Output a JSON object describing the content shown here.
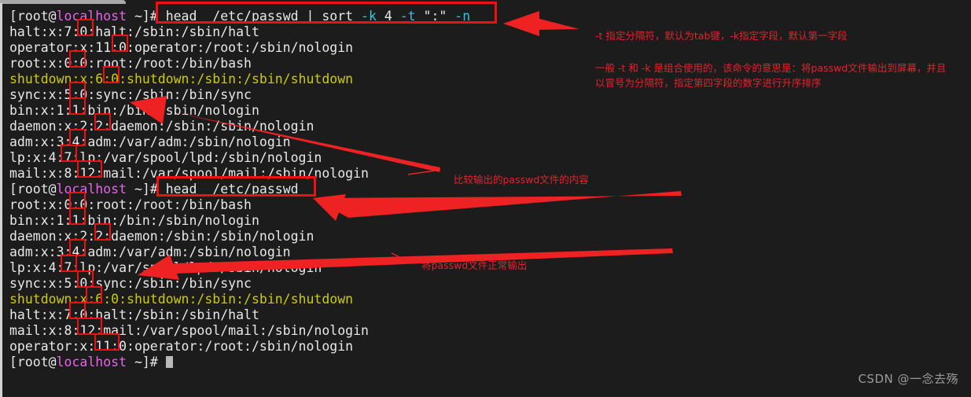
{
  "terminal": {
    "prompt": {
      "user_host_pre": "[root@",
      "host": "localhost",
      "post": " ~]# "
    },
    "lines": [
      {
        "kind": "prompt",
        "command": "head  /etc/passwd | sort ",
        "flags": "-k",
        "mid": " 4 ",
        "flag2": "-t",
        "mid2": " \":\" ",
        "flag3": "-n"
      },
      {
        "kind": "out",
        "color": "white",
        "text": "halt:x:7:0:halt:/sbin:/sbin/halt"
      },
      {
        "kind": "out",
        "color": "white",
        "text": "operator:x:11:0:operator:/root:/sbin/nologin"
      },
      {
        "kind": "out",
        "color": "white",
        "text": "root:x:0:0:root:/root:/bin/bash"
      },
      {
        "kind": "out",
        "color": "yellow",
        "text": "shutdown:x:6:0:shutdown:/sbin:/sbin/shutdown"
      },
      {
        "kind": "out",
        "color": "white",
        "text": "sync:x:5:0:sync:/sbin:/bin/sync"
      },
      {
        "kind": "out",
        "color": "white",
        "text": "bin:x:1:1:bin:/bin:/sbin/nologin"
      },
      {
        "kind": "out",
        "color": "white",
        "text": "daemon:x:2:2:daemon:/sbin:/sbin/nologin"
      },
      {
        "kind": "out",
        "color": "white",
        "text": "adm:x:3:4:adm:/var/adm:/sbin/nologin"
      },
      {
        "kind": "out",
        "color": "white",
        "text": "lp:x:4:7:lp:/var/spool/lpd:/sbin/nologin"
      },
      {
        "kind": "out",
        "color": "white",
        "text": "mail:x:8:12:mail:/var/spool/mail:/sbin/nologin"
      },
      {
        "kind": "prompt2",
        "command": "head  /etc/passwd"
      },
      {
        "kind": "out",
        "color": "white",
        "text": "root:x:0:0:root:/root:/bin/bash"
      },
      {
        "kind": "out",
        "color": "white",
        "text": "bin:x:1:1:bin:/bin:/sbin/nologin"
      },
      {
        "kind": "out",
        "color": "white",
        "text": "daemon:x:2:2:daemon:/sbin:/sbin/nologin"
      },
      {
        "kind": "out",
        "color": "white",
        "text": "adm:x:3:4:adm:/var/adm:/sbin/nologin"
      },
      {
        "kind": "out",
        "color": "white",
        "text": "lp:x:4:7:lp:/var/spool/lpd:/sbin/nologin"
      },
      {
        "kind": "out",
        "color": "white",
        "text": "sync:x:5:0:sync:/sbin:/bin/sync"
      },
      {
        "kind": "out",
        "color": "yellow",
        "text": "shutdown:x:6:0:shutdown:/sbin:/sbin/shutdown"
      },
      {
        "kind": "out",
        "color": "white",
        "text": "halt:x:7:0:halt:/sbin:/sbin/halt"
      },
      {
        "kind": "out",
        "color": "white",
        "text": "mail:x:8:12:mail:/var/spool/mail:/sbin/nologin"
      },
      {
        "kind": "out",
        "color": "white",
        "text": "operator:x:11:0:operator:/root:/sbin/nologin"
      },
      {
        "kind": "prompt_end",
        "command": ""
      }
    ]
  },
  "annotations": {
    "note1": "-t 指定分隔符，默认为tab键，-k指定字段，默认第一字段",
    "note2_line1": "一般 -t 和 -k 是组合使用的，该命令的意思是：将passwd文件输出到屏幕，并且",
    "note2_line2": "以冒号为分隔符，指定第四字段的数字进行升序排序",
    "note3": "比较输出的passwd文件的内容",
    "note4": "将passwd文件正常输出"
  },
  "watermark": {
    "text": "CSDN @一念去殇"
  },
  "colors": {
    "background": "#1c1c1c",
    "annotation_red": "#e4232d",
    "box_red": "#ee1111",
    "prompt_host": "#e864e8",
    "text_white": "#e8e8e8",
    "text_yellow": "#cdcd00",
    "flag_cyan": "#2fc8d8",
    "watermark_grey": "#9a9a9a"
  }
}
